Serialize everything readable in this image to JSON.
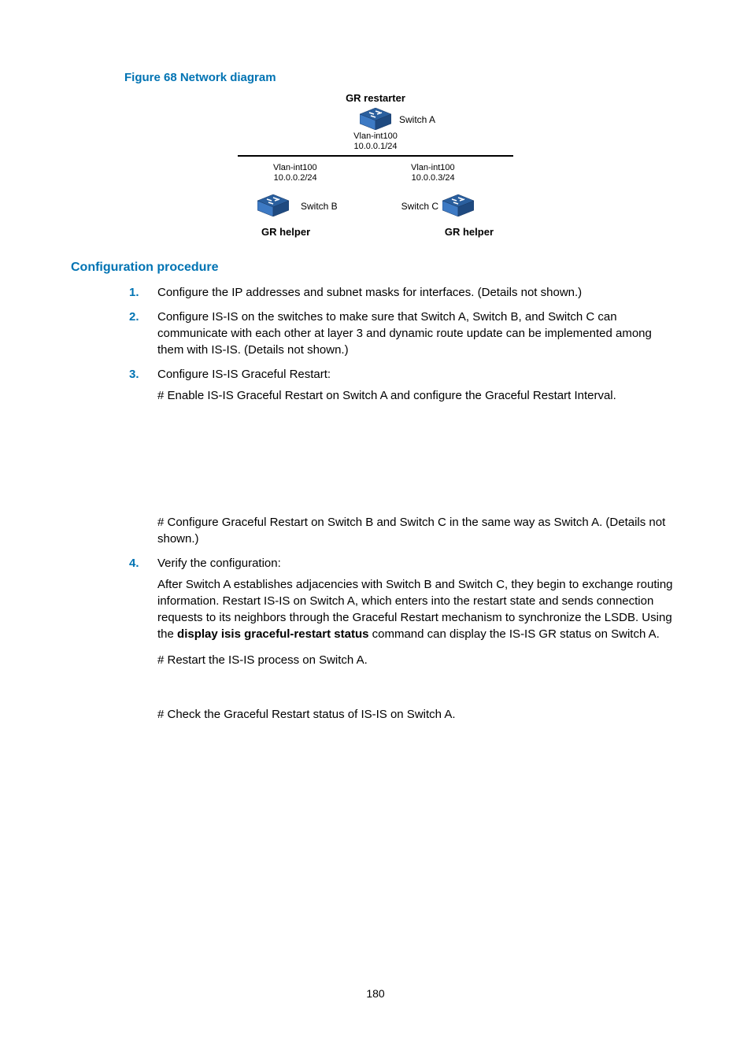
{
  "figure": {
    "title": "Figure 68 Network diagram",
    "gr_restarter": "GR restarter",
    "switch_a": "Switch A",
    "switch_b": "Switch B",
    "switch_c": "Switch C",
    "vlan_a_line1": "Vlan-int100",
    "vlan_a_line2": "10.0.0.1/24",
    "vlan_b_line1": "Vlan-int100",
    "vlan_b_line2": "10.0.0.2/24",
    "vlan_c_line1": "Vlan-int100",
    "vlan_c_line2": "10.0.0.3/24",
    "gr_helper": "GR helper"
  },
  "section_heading": "Configuration procedure",
  "steps": {
    "s1": "Configure the IP addresses and subnet masks for interfaces. (Details not shown.)",
    "s2": "Configure IS-IS on the switches to make sure that Switch A, Switch B, and Switch C can communicate with each other at layer 3 and dynamic route update can be implemented among them with IS-IS. (Details not shown.)",
    "s3": "Configure IS-IS Graceful Restart:",
    "s3_sub1": "# Enable IS-IS Graceful Restart on Switch A and configure the Graceful Restart Interval.",
    "s3_sub2": "# Configure Graceful Restart on Switch B and Switch C in the same way as Switch A. (Details not shown.)",
    "s4": "Verify the configuration:",
    "s4_p1a": "After Switch A establishes adjacencies with Switch B and Switch C, they begin to exchange routing information. Restart IS-IS on Switch A, which enters into the restart state and sends connection requests to its neighbors through the Graceful Restart mechanism to synchronize the LSDB. Using the ",
    "s4_cmd": "display isis graceful-restart status",
    "s4_p1b": " command can display the IS-IS GR status on Switch A.",
    "s4_sub2": "# Restart the IS-IS process on Switch A.",
    "s4_sub3": "# Check the Graceful Restart status of IS-IS on Switch A."
  },
  "page_number": "180"
}
